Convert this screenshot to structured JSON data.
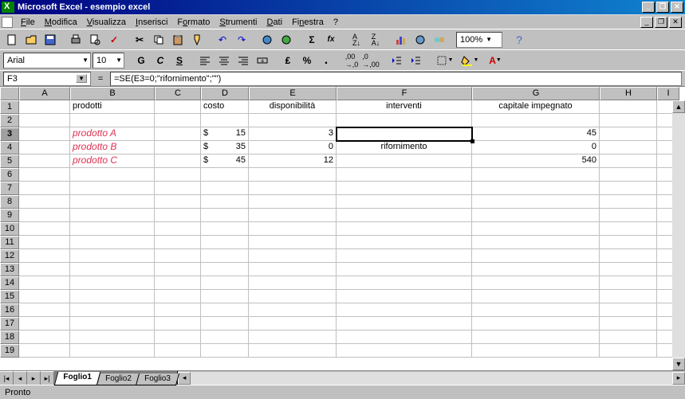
{
  "window": {
    "title": "Microsoft Excel - esempio excel",
    "min": "_",
    "max": "❐",
    "close": "✕"
  },
  "menu": {
    "items": [
      "File",
      "Modifica",
      "Visualizza",
      "Inserisci",
      "Formato",
      "Strumenti",
      "Dati",
      "Finestra",
      "?"
    ],
    "doc_min": "_",
    "doc_restore": "❐",
    "doc_close": "✕"
  },
  "toolbar1": {
    "zoom": "100%"
  },
  "toolbar2": {
    "font": "Arial",
    "size": "10"
  },
  "formula": {
    "cell_ref": "F3",
    "eq": "=",
    "value": "=SE(E3=0;\"rifornimento\";\"\")"
  },
  "columns": [
    "A",
    "B",
    "C",
    "D",
    "E",
    "F",
    "G",
    "H",
    "I"
  ],
  "row_count": 19,
  "selected_row": 3,
  "headers": {
    "B": "prodotti",
    "D": "costo",
    "E": "disponibilità",
    "F": "interventi",
    "G": "capitale impegnato"
  },
  "data_rows": [
    {
      "row": 3,
      "B": "prodotto A",
      "D_sym": "$",
      "D": "15",
      "E": "3",
      "F": "",
      "G": "45"
    },
    {
      "row": 4,
      "B": "prodotto B",
      "D_sym": "$",
      "D": "35",
      "E": "0",
      "F": "rifornimento",
      "G": "0"
    },
    {
      "row": 5,
      "B": "prodotto C",
      "D_sym": "$",
      "D": "45",
      "E": "12",
      "F": "",
      "G": "540"
    }
  ],
  "tabs": {
    "nav": [
      "|◂",
      "◂",
      "▸",
      "▸|"
    ],
    "sheets": [
      "Foglio1",
      "Foglio2",
      "Foglio3"
    ],
    "active": 0
  },
  "status": {
    "text": "Pronto"
  },
  "chart_data": {
    "type": "table",
    "title": "esempio excel",
    "columns": [
      "prodotti",
      "costo",
      "disponibilità",
      "interventi",
      "capitale impegnato"
    ],
    "rows": [
      [
        "prodotto A",
        15,
        3,
        "",
        45
      ],
      [
        "prodotto B",
        35,
        0,
        "rifornimento",
        0
      ],
      [
        "prodotto C",
        45,
        12,
        "",
        540
      ]
    ],
    "currency_column": "costo",
    "currency_symbol": "$",
    "formula_F": "=SE(E=0;\"rifornimento\";\"\")"
  }
}
